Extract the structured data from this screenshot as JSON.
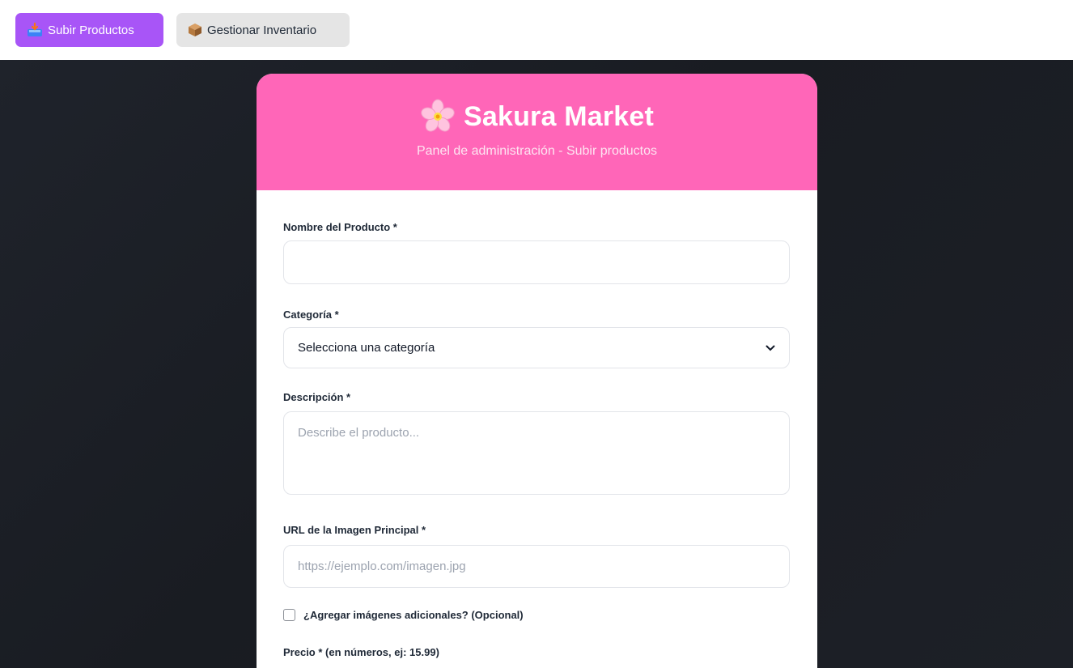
{
  "nav": {
    "upload_label": "Subir Productos",
    "upload_icon": "inbox-tray-icon",
    "inventory_label": "Gestionar Inventario",
    "inventory_icon": "package-icon",
    "accent_color": "#a855f7"
  },
  "header": {
    "logo_icon": "cherry-blossom-icon",
    "title": "Sakura Market",
    "subtitle": "Panel de administración - Subir productos",
    "brand_color": "#ff66b8"
  },
  "form": {
    "name_label": "Nombre del Producto *",
    "name_value": "",
    "category_label": "Categoría *",
    "category_selected": "Selecciona una categoría",
    "description_label": "Descripción *",
    "description_placeholder": "Describe el producto...",
    "image_label": "URL de la Imagen Principal *",
    "image_placeholder": "https://ejemplo.com/imagen.jpg",
    "extra_images_label": "¿Agregar imágenes adicionales? (Opcional)",
    "extra_images_checked": false,
    "price_label": "Precio * (en números, ej: 15.99)"
  }
}
